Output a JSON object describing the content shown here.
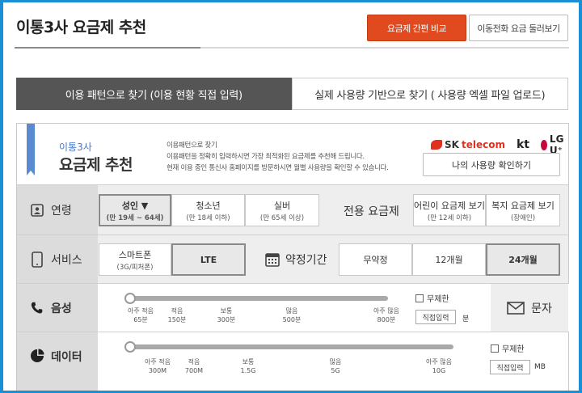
{
  "header": {
    "title": "이통3사 요금제 추천",
    "compare_button": "요금제 간편 비교",
    "browse_button": "이동전화 요금 둘러보기"
  },
  "tabs": [
    {
      "label": "이용 패턴으로 찾기 (이용 현황 직접 입력)",
      "active": true
    },
    {
      "label": "실제 사용량 기반으로 찾기 ( 사용량 엑셀 파일 업로드)",
      "active": false
    }
  ],
  "rec": {
    "subtitle": "이통3사",
    "title": "요금제 추천",
    "desc_heading": "이용패턴으로 찾기",
    "desc_line1": "이용패턴을 정확히 입력하시면 가장 최적화된 요금제를 추천해 드립니다.",
    "desc_line2": "현재 이용 중인 통신사 홈페이지를 방문하시면 월별 사용량을 확인할 수 있습니다.",
    "carriers": {
      "sk_prefix": "SK",
      "sk": "telecom",
      "kt": "kt",
      "lg": "LG U⁺"
    },
    "usage_button": "나의 사용량 확인하기"
  },
  "age": {
    "label": "연령",
    "options": [
      {
        "title": "성인 ▼",
        "sub": "(만 19세 ~ 64세)",
        "selected": true
      },
      {
        "title": "청소년",
        "sub": "(만 18세 이하)",
        "selected": false
      },
      {
        "title": "실버",
        "sub": "(만 65세 이상)",
        "selected": false
      }
    ],
    "dedicated_label": "전용 요금제",
    "dedicated": [
      {
        "title": "어린이 요금제 보기",
        "sub": "(만 12세 이하)"
      },
      {
        "title": "복지 요금제 보기",
        "sub": "(장애인)"
      }
    ]
  },
  "service": {
    "label": "서비스",
    "options": [
      {
        "title": "스마트폰",
        "sub": "(3G/피처폰)",
        "selected": false
      },
      {
        "title": "LTE",
        "sub": "",
        "selected": true
      }
    ],
    "contract_label": "약정기간",
    "contract": [
      {
        "title": "무약정",
        "selected": false
      },
      {
        "title": "12개월",
        "selected": false
      },
      {
        "title": "24개월",
        "selected": true
      }
    ]
  },
  "voice": {
    "label": "음성",
    "ticks": [
      {
        "a": "아주 적음",
        "b": "65분"
      },
      {
        "a": "적음",
        "b": "150분"
      },
      {
        "a": "보통",
        "b": "300분"
      },
      {
        "a": "많음",
        "b": "500분"
      },
      {
        "a": "아주 많음",
        "b": "800분"
      }
    ],
    "unlimited": "무제한",
    "direct": "직접입력",
    "unit": "분",
    "sms_label": "문자"
  },
  "data": {
    "label": "데이터",
    "ticks": [
      {
        "a": "아주 적음",
        "b": "300M"
      },
      {
        "a": "적음",
        "b": "700M"
      },
      {
        "a": "보통",
        "b": "1.5G"
      },
      {
        "a": "많음",
        "b": "5G"
      },
      {
        "a": "아주 많음",
        "b": "10G"
      }
    ],
    "unlimited": "무제한",
    "direct": "직접입력",
    "unit": "MB"
  }
}
